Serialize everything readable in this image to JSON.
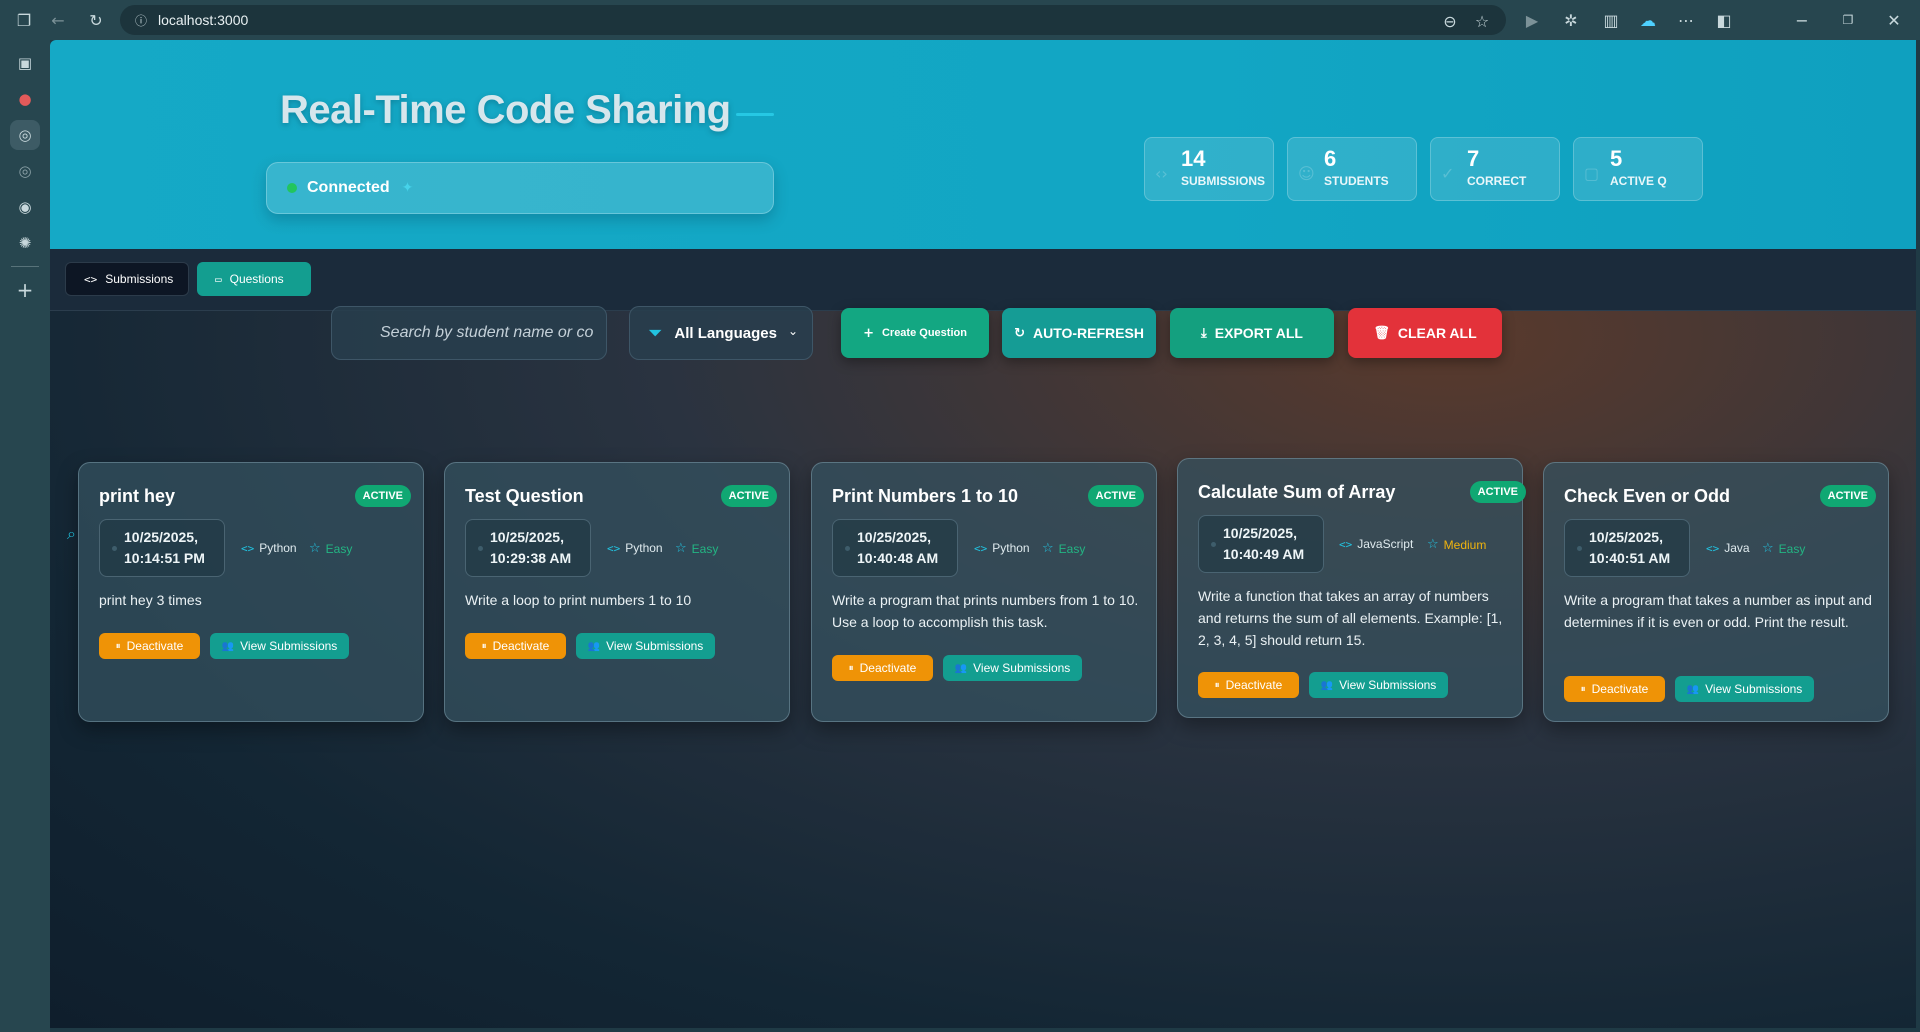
{
  "browser": {
    "url": "localhost:3000"
  },
  "header": {
    "title": "Real-Time Code Sharing",
    "status": "Connected",
    "stats": [
      {
        "value": "14",
        "label": "SUBMISSIONS"
      },
      {
        "value": "6",
        "label": "STUDENTS"
      },
      {
        "value": "7",
        "label": "CORRECT"
      },
      {
        "value": "5",
        "label": "ACTIVE Q"
      }
    ]
  },
  "tabs": [
    {
      "label": "Submissions"
    },
    {
      "label": "Questions"
    }
  ],
  "toolbar": {
    "search_placeholder": "Search by student name or co",
    "language_filter": "All Languages",
    "create_label": "Create Question",
    "auto_refresh_label": "AUTO-REFRESH",
    "export_label": "EXPORT ALL",
    "clear_label": "CLEAR ALL"
  },
  "cards": [
    {
      "title": "print hey",
      "badge": "ACTIVE",
      "date": "10/25/2025,",
      "time": "10:14:51 PM",
      "language": "Python",
      "difficulty": "Easy",
      "description": "print hey 3 times",
      "deactivate": "Deactivate",
      "view": "View Submissions"
    },
    {
      "title": "Test Question",
      "badge": "ACTIVE",
      "date": "10/25/2025,",
      "time": "10:29:38 AM",
      "language": "Python",
      "difficulty": "Easy",
      "description": "Write a loop to print numbers 1 to 10",
      "deactivate": "Deactivate",
      "view": "View Submissions"
    },
    {
      "title": "Print Numbers 1 to 10",
      "badge": "ACTIVE",
      "date": "10/25/2025,",
      "time": "10:40:48 AM",
      "language": "Python",
      "difficulty": "Easy",
      "description": "Write a program that prints numbers from 1 to 10. Use a loop to accomplish this task.",
      "deactivate": "Deactivate",
      "view": "View Submissions"
    },
    {
      "title": "Calculate Sum of Array",
      "badge": "ACTIVE",
      "date": "10/25/2025,",
      "time": "10:40:49 AM",
      "language": "JavaScript",
      "difficulty": "Medium",
      "description": "Write a function that takes an array of numbers and returns the sum of all elements. Example: [1, 2, 3, 4, 5] should return 15.",
      "deactivate": "Deactivate",
      "view": "View Submissions"
    },
    {
      "title": "Check Even or Odd",
      "badge": "ACTIVE",
      "date": "10/25/2025,",
      "time": "10:40:51 AM",
      "language": "Java",
      "difficulty": "Easy",
      "description": "Write a program that takes a number as input and determines if it is even or odd. Print the result.",
      "deactivate": "Deactivate",
      "view": "View Submissions"
    }
  ]
}
